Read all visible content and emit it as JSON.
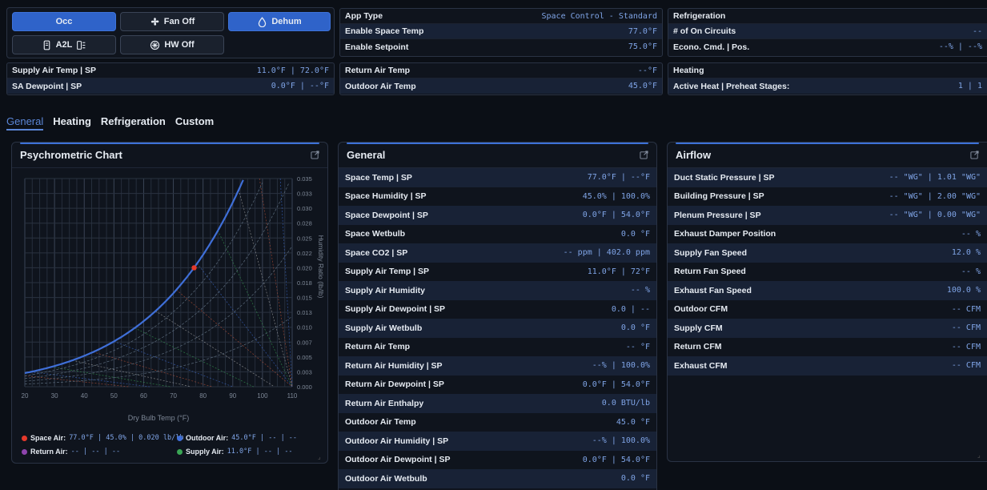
{
  "controls": {
    "occ": "Occ",
    "fan": "Fan Off",
    "dehum": "Dehum",
    "a2l": "A2L",
    "hw": "HW Off"
  },
  "app_box": [
    {
      "label": "App Type",
      "value": "Space Control - Standard"
    },
    {
      "label": "Enable Space Temp",
      "value": "77.0°F"
    },
    {
      "label": "Enable Setpoint",
      "value": "75.0°F"
    }
  ],
  "refrig_box": [
    {
      "label": "Refrigeration",
      "value": ""
    },
    {
      "label": "# of On Circuits",
      "value": "--"
    },
    {
      "label": "Econo. Cmd. | Pos.",
      "value": "--% | --%"
    }
  ],
  "supply_box": [
    {
      "label": "Supply Air Temp | SP",
      "value": "11.0°F | 72.0°F"
    },
    {
      "label": "SA Dewpoint | SP",
      "value": "0.0°F | --°F"
    }
  ],
  "return_box": [
    {
      "label": "Return Air Temp",
      "value": "--°F"
    },
    {
      "label": "Outdoor Air Temp",
      "value": "45.0°F"
    }
  ],
  "heating_box": [
    {
      "label": "Heating",
      "value": ""
    },
    {
      "label": "Active Heat | Preheat Stages:",
      "value": "1 | 1"
    }
  ],
  "tabs": [
    "General",
    "Heating",
    "Refrigeration",
    "Custom"
  ],
  "psychro": {
    "title": "Psychrometric Chart",
    "x_ticks": [
      "20",
      "30",
      "40",
      "50",
      "60",
      "70",
      "80",
      "90",
      "100",
      "110"
    ],
    "y_ticks": [
      "0.035",
      "0.033",
      "0.030",
      "0.028",
      "0.025",
      "0.022",
      "0.020",
      "0.018",
      "0.015",
      "0.013",
      "0.010",
      "0.007",
      "0.005",
      "0.003",
      "0.000"
    ],
    "xlabel": "Dry Bulb Temp (°F)",
    "ylabel": "Humidity Ratio (lb/lb)",
    "legend": {
      "space_label": "Space Air:",
      "space_value": "77.0°F | 45.0% | 0.020 lb/lb",
      "outdoor_label": "Outdoor Air:",
      "outdoor_value": "45.0°F | -- | --",
      "return_label": "Return Air:",
      "return_value": "-- | -- | --",
      "supply_label": "Supply Air:",
      "supply_value": "11.0°F | -- | --"
    },
    "colors": {
      "space": "#e5392b",
      "outdoor": "#3f6fd8",
      "return": "#8e44ad",
      "supply": "#3aa655"
    }
  },
  "general": {
    "title": "General",
    "rows": [
      {
        "label": "Space Temp | SP",
        "value": "77.0°F | --°F"
      },
      {
        "label": "Space Humidity | SP",
        "value": "45.0% | 100.0%"
      },
      {
        "label": "Space Dewpoint | SP",
        "value": "0.0°F | 54.0°F"
      },
      {
        "label": "Space Wetbulb",
        "value": "0.0 °F"
      },
      {
        "label": "Space CO2 | SP",
        "value": "-- ppm | 402.0 ppm"
      },
      {
        "label": "Supply Air Temp | SP",
        "value": "11.0°F | 72°F"
      },
      {
        "label": "Supply Air Humidity",
        "value": "-- %"
      },
      {
        "label": "Supply Air Dewpoint | SP",
        "value": "0.0 | --"
      },
      {
        "label": "Supply Air Wetbulb",
        "value": "0.0 °F"
      },
      {
        "label": "Return Air Temp",
        "value": "-- °F"
      },
      {
        "label": "Return Air Humidity | SP",
        "value": "--% | 100.0%"
      },
      {
        "label": "Return Air Dewpoint | SP",
        "value": "0.0°F | 54.0°F"
      },
      {
        "label": "Return Air Enthalpy",
        "value": "0.0 BTU/lb"
      },
      {
        "label": "Outdoor Air Temp",
        "value": "45.0 °F"
      },
      {
        "label": "Outdoor Air Humidity | SP",
        "value": "--% | 100.0%"
      },
      {
        "label": "Outdoor Air Dewpoint | SP",
        "value": "0.0°F | 54.0°F"
      },
      {
        "label": "Outdoor Air Wetbulb",
        "value": "0.0 °F"
      }
    ]
  },
  "airflow": {
    "title": "Airflow",
    "rows": [
      {
        "label": "Duct Static Pressure | SP",
        "value": "-- \"WG\" | 1.01 \"WG\""
      },
      {
        "label": "Building Pressure | SP",
        "value": "-- \"WG\" | 2.00 \"WG\""
      },
      {
        "label": "Plenum Pressure | SP",
        "value": "-- \"WG\" | 0.00 \"WG\""
      },
      {
        "label": "Exhaust Damper Position",
        "value": "-- %"
      },
      {
        "label": "Supply Fan Speed",
        "value": "12.0 %"
      },
      {
        "label": "Return Fan Speed",
        "value": "-- %"
      },
      {
        "label": "Exhaust Fan Speed",
        "value": "100.0 %"
      },
      {
        "label": "Outdoor CFM",
        "value": "-- CFM"
      },
      {
        "label": "Supply CFM",
        "value": "-- CFM"
      },
      {
        "label": "Return CFM",
        "value": "-- CFM"
      },
      {
        "label": "Exhaust CFM",
        "value": "-- CFM"
      }
    ]
  }
}
